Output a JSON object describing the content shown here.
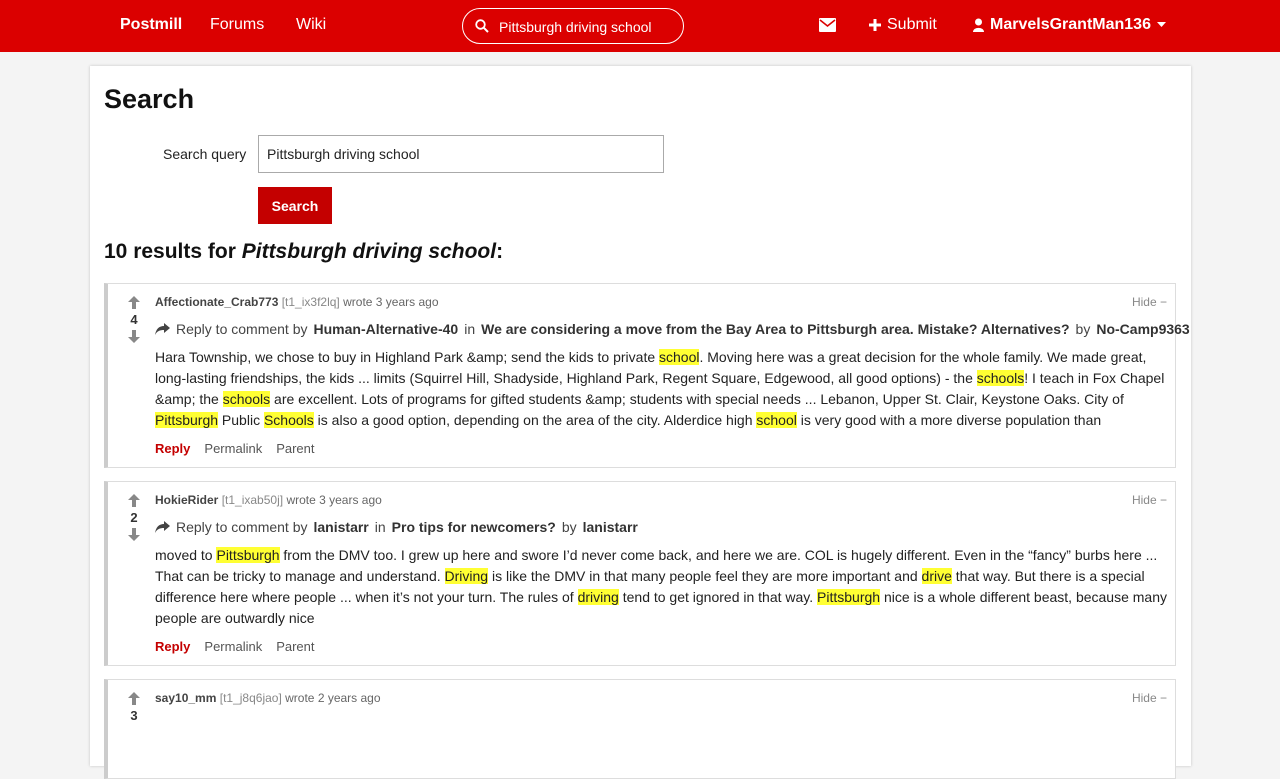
{
  "topbar": {
    "brand": "Postmill",
    "nav": [
      "Forums",
      "Wiki"
    ],
    "search_value": "Pittsburgh driving school",
    "submit_label": "Submit",
    "username": "MarvelsGrantMan136"
  },
  "page": {
    "title": "Search",
    "query_label": "Search query",
    "query_value": "Pittsburgh driving school",
    "search_button": "Search",
    "results_count_prefix": "10 results for ",
    "results_query": "Pittsburgh driving school",
    "results_suffix": ":"
  },
  "results": [
    {
      "author": "Affectionate_Crab773",
      "id": "[t1_ix3f2lq]",
      "when": "wrote 3 years ago",
      "hide": "Hide −",
      "score": "4",
      "reply_to_label": "Reply to comment by",
      "reply_to_user": "Human-Alternative-40",
      "in_label": "in",
      "thread": "We are considering a move from the Bay Area to Pittsburgh area. Mistake? Alternatives?",
      "by_label": "by",
      "thread_author": "No-Camp9363",
      "actions": [
        "Reply",
        "Permalink",
        "Parent"
      ]
    },
    {
      "author": "HokieRider",
      "id": "[t1_ixab50j]",
      "when": "wrote 3 years ago",
      "hide": "Hide −",
      "score": "2",
      "reply_to_label": "Reply to comment by",
      "reply_to_user": "lanistarr",
      "in_label": "in",
      "thread": "Pro tips for newcomers?",
      "by_label": "by",
      "thread_author": "lanistarr",
      "actions": [
        "Reply",
        "Permalink",
        "Parent"
      ]
    },
    {
      "author": "say10_mm",
      "id": "[t1_j8q6jao]",
      "when": "wrote 2 years ago",
      "hide": "Hide −",
      "score": "3"
    }
  ],
  "result_bodies": {
    "r0": [
      {
        "t": "Hara Township, we chose to buy in Highland Park &amp; send the kids to private "
      },
      {
        "t": "school",
        "h": true
      },
      {
        "t": ". Moving here was a great decision for the whole family. We made great, long-lasting friendships, the kids ... limits (Squirrel Hill, Shadyside, Highland Park, Regent Square, Edgewood, all good options) - the "
      },
      {
        "t": "schools",
        "h": true
      },
      {
        "t": "! I teach in Fox Chapel &amp; the "
      },
      {
        "t": "schools",
        "h": true
      },
      {
        "t": " are excellent. Lots of programs for gifted students &amp; students with special needs ... Lebanon, Upper St. Clair, Keystone Oaks. City of "
      },
      {
        "t": "Pittsburgh",
        "h": true
      },
      {
        "t": " Public "
      },
      {
        "t": "Schools",
        "h": true
      },
      {
        "t": " is also a good option, depending on the area of the city. Alderdice high "
      },
      {
        "t": "school",
        "h": true
      },
      {
        "t": " is very good with a more diverse population than"
      }
    ],
    "r1": [
      {
        "t": "moved to "
      },
      {
        "t": "Pittsburgh",
        "h": true
      },
      {
        "t": " from the DMV too. I grew up here and swore I’d never come back, and here we are. COL is hugely different. Even in the “fancy” burbs here ... That can be tricky to manage and understand. "
      },
      {
        "t": "Driving",
        "h": true
      },
      {
        "t": " is like the DMV in that many people feel they are more important and "
      },
      {
        "t": "drive",
        "h": true
      },
      {
        "t": " that way. But there is a special difference here where people ... when it’s not your turn. The rules of "
      },
      {
        "t": "driving",
        "h": true
      },
      {
        "t": " tend to get ignored in that way. "
      },
      {
        "t": "Pittsburgh",
        "h": true
      },
      {
        "t": " nice is a whole different beast, because many people are outwardly nice"
      }
    ]
  }
}
